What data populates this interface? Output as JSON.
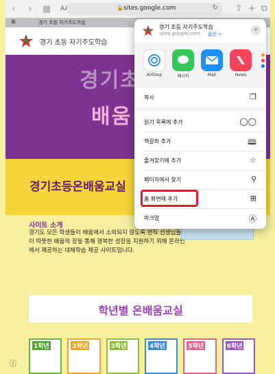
{
  "toolbar": {
    "aa_label": "AA",
    "url": "sites.google.com"
  },
  "tab": {
    "title": "경기 초등 자기주도학습"
  },
  "site": {
    "title": "경기 초등 자기주도학습",
    "banner_line1": "경기초",
    "banner_line2": "배움",
    "strip_title": "경기초등온배움교실",
    "about_title": "사이트 소개",
    "about_text": "경기도 모든 학생들이 배움에서 소외되지 않도록 현직 선생님들이 따뜻한 배움의 장을 통해 행복한 성장을 지원하기 위해 온라인에서 제공하는 대체학습 제공 사이트입니다.",
    "grade_title": "학년별 온배움교실",
    "grades": [
      "1학년",
      "2학년",
      "3학년",
      "4학년",
      "5학년",
      "6학년"
    ]
  },
  "share_sheet": {
    "title": "경기 초등 자기주도학습",
    "url": "sites.google.com",
    "options_label": "옵션 >",
    "apps": [
      {
        "label": "AirDrop",
        "icon": "airdrop-icon",
        "color": "#3a8de6"
      },
      {
        "label": "메시지",
        "icon": "messages-icon",
        "color": "#34c759"
      },
      {
        "label": "Mail",
        "icon": "mail-icon",
        "color": "#1d8ff5"
      },
      {
        "label": "News",
        "icon": "news-icon",
        "color": "#f5445c"
      }
    ],
    "copy_label": "복사",
    "actions": [
      {
        "label": "읽기 목록에 추가",
        "icon": "reading-list-icon"
      },
      {
        "label": "책갈피 추가",
        "icon": "bookmark-icon"
      },
      {
        "label": "즐겨찾기에 추가",
        "icon": "star-icon"
      },
      {
        "label": "페이지에서 찾기",
        "icon": "search-icon"
      },
      {
        "label": "홈 화면에 추가",
        "icon": "add-square-icon"
      },
      {
        "label": "마크업",
        "icon": "markup-icon"
      }
    ]
  },
  "highlight_color": "#e5182c"
}
